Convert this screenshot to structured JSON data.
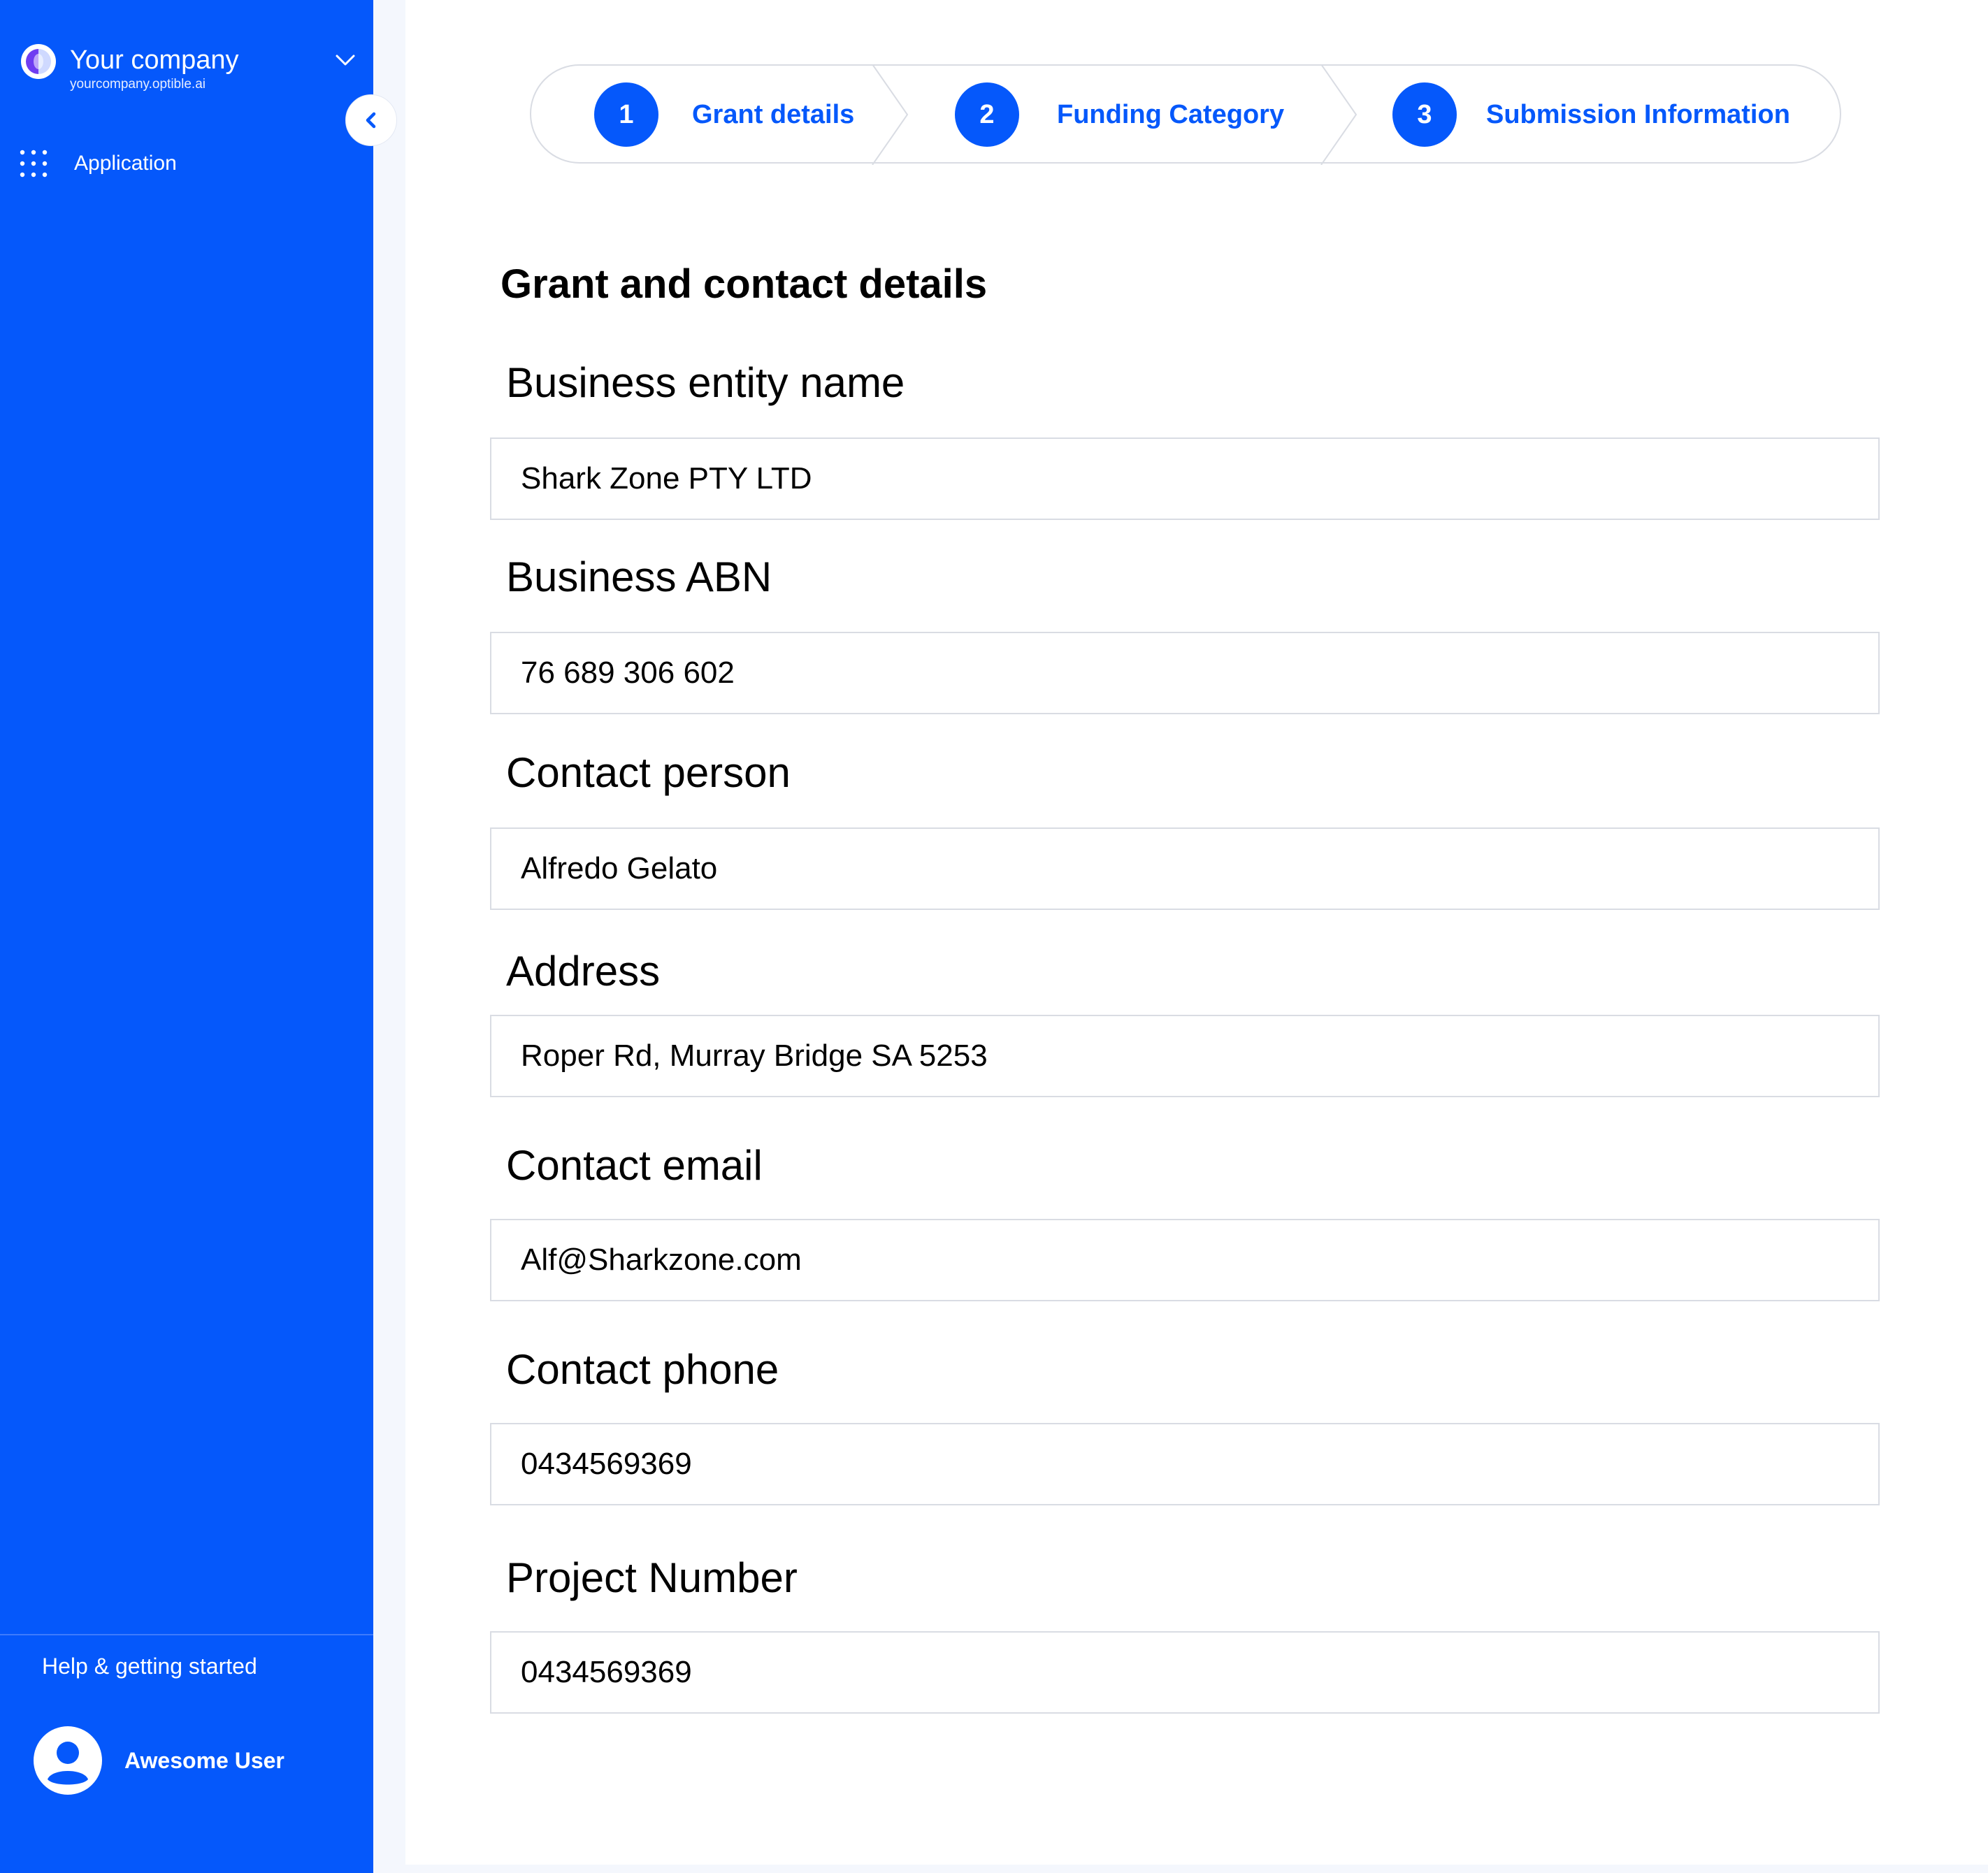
{
  "sidebar": {
    "company_name": "Your company",
    "company_url": "yourcompany.optible.ai",
    "nav_items": [
      {
        "label": "Application",
        "icon": "grid-icon"
      }
    ],
    "help_label": "Help & getting started",
    "user_name": "Awesome User"
  },
  "stepper": {
    "steps": [
      {
        "number": "1",
        "label": "Grant details"
      },
      {
        "number": "2",
        "label": "Funding Category"
      },
      {
        "number": "3",
        "label": "Submission Information"
      }
    ]
  },
  "form": {
    "title": "Grant and contact details",
    "fields": [
      {
        "label": "Business entity name",
        "value": "Shark Zone PTY LTD"
      },
      {
        "label": "Business ABN",
        "value": "76 689 306 602"
      },
      {
        "label": "Contact person",
        "value": "Alfredo Gelato"
      },
      {
        "label": "Address",
        "value": "Roper Rd, Murray Bridge SA 5253"
      },
      {
        "label": "Contact email",
        "value": "Alf@Sharkzone.com"
      },
      {
        "label": "Contact phone",
        "value": "0434569369"
      },
      {
        "label": "Project Number",
        "value": "0434569369"
      }
    ]
  },
  "colors": {
    "brand_blue": "#0558fb",
    "page_background": "#f4f7fd",
    "border_gray": "#d9dce3"
  }
}
